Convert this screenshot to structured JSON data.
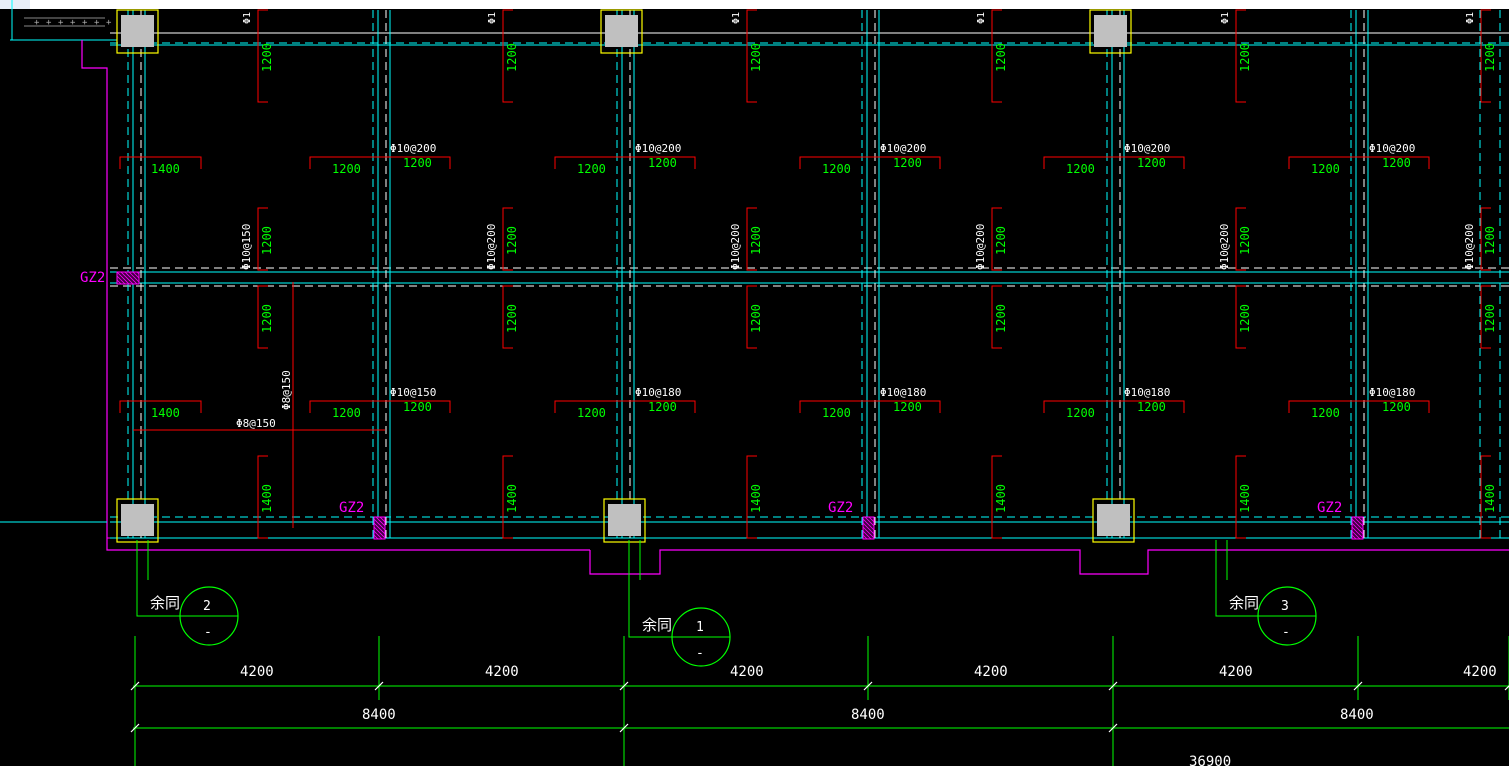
{
  "colors": {
    "background": "#000000",
    "top_bar": "#ffffff",
    "column_outline": "#ffff00",
    "column_fill": "#c0c0c0",
    "cyan": "#00ffff",
    "white": "#ffffff",
    "red": "#ff0000",
    "green": "#00ff00",
    "magenta": "#ff00ff",
    "dim_green": "#00ff00"
  },
  "rebar_top_row": [
    "Φ10@200",
    "Φ10@200",
    "Φ10@200",
    "Φ10@200",
    "Φ10@200"
  ],
  "rebar_bottom_row": [
    "Φ10@150",
    "Φ10@180",
    "Φ10@180",
    "Φ10@180",
    "Φ10@180"
  ],
  "rebar_vertical": [
    "Φ10@150",
    "Φ10@200",
    "Φ10@200",
    "Φ10@200",
    "Φ10@200",
    "Φ10@200"
  ],
  "rebar_distribution": [
    "Φ8@150",
    "Φ8@150"
  ],
  "lengths": {
    "l1200": "1200",
    "l1400": "1400"
  },
  "constructional_column": "GZ2",
  "detail_note": "余同",
  "callouts": [
    {
      "number": "2",
      "sheet": "-"
    },
    {
      "number": "1",
      "sheet": "-"
    },
    {
      "number": "3",
      "sheet": "-"
    }
  ],
  "dimensions": {
    "row1": [
      "4200",
      "4200",
      "4200",
      "4200",
      "4200",
      "4200"
    ],
    "row2": [
      "8400",
      "8400",
      "8400"
    ],
    "total": "36900"
  }
}
